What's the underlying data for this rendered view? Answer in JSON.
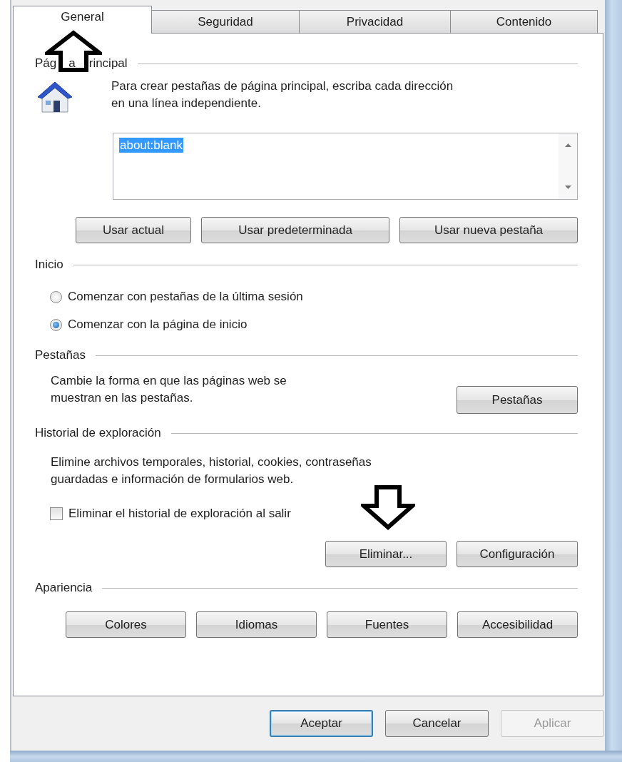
{
  "tabs": [
    {
      "label": "General",
      "selected": true
    },
    {
      "label": "Seguridad",
      "selected": false
    },
    {
      "label": "Privacidad",
      "selected": false
    },
    {
      "label": "Contenido",
      "selected": false
    }
  ],
  "home_page": {
    "legend_parts": [
      "Pág",
      "a",
      "rincipal"
    ],
    "description": "Para crear pestañas de página principal, escriba cada dirección\nen una línea independiente.",
    "addresses": {
      "value": "about:blank",
      "selected": true
    },
    "buttons": [
      "Usar actual",
      "Usar predeterminada",
      "Usar nueva pestaña"
    ]
  },
  "startup": {
    "legend": "Inicio",
    "options": [
      {
        "label": "Comenzar con pestañas de la última sesión",
        "selected": false
      },
      {
        "label": "Comenzar con la página de inicio",
        "selected": true
      }
    ]
  },
  "tabs_section": {
    "legend": "Pestañas",
    "description": "Cambie la forma en que las páginas web se\nmuestran en las pestañas.",
    "button": "Pestañas"
  },
  "history": {
    "legend": "Historial de exploración",
    "description": "Elimine archivos temporales, historial, cookies, contraseñas\nguardadas e información de formularios web.",
    "checkbox": {
      "label": "Eliminar el historial de exploración al salir",
      "checked": false
    },
    "buttons": [
      "Eliminar...",
      "Configuración"
    ]
  },
  "appearance": {
    "legend": "Apariencia",
    "buttons": [
      "Colores",
      "Idiomas",
      "Fuentes",
      "Accesibilidad"
    ]
  },
  "dialog_buttons": [
    {
      "label": "Aceptar",
      "default": true,
      "disabled": false
    },
    {
      "label": "Cancelar",
      "default": false,
      "disabled": false
    },
    {
      "label": "Aplicar",
      "default": false,
      "disabled": true
    }
  ],
  "annotations": [
    {
      "kind": "up"
    },
    {
      "kind": "down"
    }
  ]
}
